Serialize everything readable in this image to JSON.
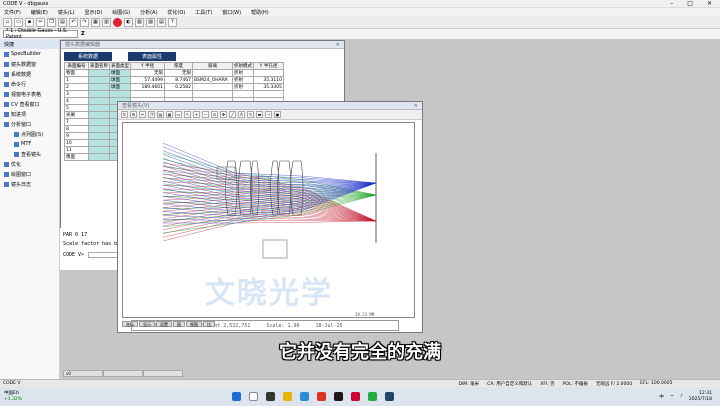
{
  "app": {
    "title": "CODE V - dbgauss",
    "doc_title": "* 1 : Double Gauss - U.S. Patent",
    "z_label": "Z"
  },
  "menu": [
    "文件(F)",
    "编辑(E)",
    "镜头(L)",
    "显示(D)",
    "绘图(G)",
    "分析(A)",
    "优化(O)",
    "工具(T)",
    "窗口(W)",
    "帮助(H)"
  ],
  "sidebar": {
    "root": "快捷",
    "items": [
      "SpecBuilder",
      "镜头数据窗",
      "系统数据",
      "命令行",
      "视窗电子表格",
      "CV 查看窗口",
      "知进项",
      "分析窗口",
      "点列图(S)",
      "MTF",
      "查看镜头",
      "优化",
      "绘图窗口",
      "镜头日志"
    ]
  },
  "win1": {
    "title": "镜头数据编辑器",
    "tabs": [
      "系统数据",
      "表面属性"
    ],
    "headers": [
      "表面编号",
      "表面名称",
      "表面类型",
      "Y 半径",
      "厚度",
      "玻璃",
      "折射模式",
      "Y 半孔径"
    ],
    "rows": [
      [
        "物面",
        "",
        "球面",
        "无限",
        "无限",
        "",
        "折射",
        ""
      ],
      [
        "1",
        "",
        "球面",
        "57.4499",
        "8.7467",
        "BSM24_OHARA",
        "折射",
        "35.3110"
      ],
      [
        "2",
        "",
        "球面",
        "189.4601",
        "0.2582",
        "",
        "折射",
        "35.3305"
      ],
      [
        "3",
        "",
        "",
        "",
        "",
        "",
        "",
        ""
      ],
      [
        "4",
        "",
        "",
        "",
        "",
        "",
        "",
        ""
      ],
      [
        "5",
        "",
        "",
        "",
        "",
        "",
        "",
        ""
      ],
      [
        "光阑",
        "",
        "",
        "",
        "",
        "",
        "",
        ""
      ],
      [
        "7",
        "",
        "",
        "",
        "",
        "",
        "",
        ""
      ],
      [
        "8",
        "",
        "",
        "",
        "",
        "",
        "",
        ""
      ],
      [
        "9",
        "",
        "",
        "",
        "",
        "",
        "",
        ""
      ],
      [
        "10",
        "",
        "",
        "",
        "",
        "",
        "",
        ""
      ],
      [
        "11",
        "",
        "",
        "",
        "",
        "",
        "",
        ""
      ],
      [
        "像面",
        "",
        "",
        "",
        "",
        "",
        "",
        ""
      ]
    ],
    "cmd_lines": [
      "PAR 0 17",
      "Scale factor has be"
    ],
    "cmd_prompt": "CODE V>"
  },
  "win2": {
    "title": "查看镜头(V)",
    "info_title": "Double Gauss - U.S. Patent 2,532,751",
    "info_scale": "Scale:   1.90",
    "info_date": "18-Jul-25",
    "scale_bar": "19.23   MM",
    "subtabs": [
      "坐标",
      "显示",
      "设置",
      "图",
      "视图",
      "比"
    ]
  },
  "subtitle": "它并没有完全的充满",
  "watermark": "文晓光学",
  "status": {
    "left": "CODE V",
    "dim": "DIM: 毫米",
    "ca": "CA: 用户自定义和默认",
    "xfi": "XFI: 否",
    "pol": "POL: 不偏振",
    "inf": "无限远 F/ 2.0000",
    "efl": "EFL: 100.0005"
  },
  "taskbar": {
    "weather": "中国Eti",
    "weather2": "+1.32%",
    "time": "12:31",
    "date": "2025/7/18",
    "lang": "中"
  },
  "colors": {
    "ray_red": "#c0182c",
    "ray_green": "#18a018",
    "ray_blue": "#1830c8",
    "accent": "#1b3a6e"
  }
}
